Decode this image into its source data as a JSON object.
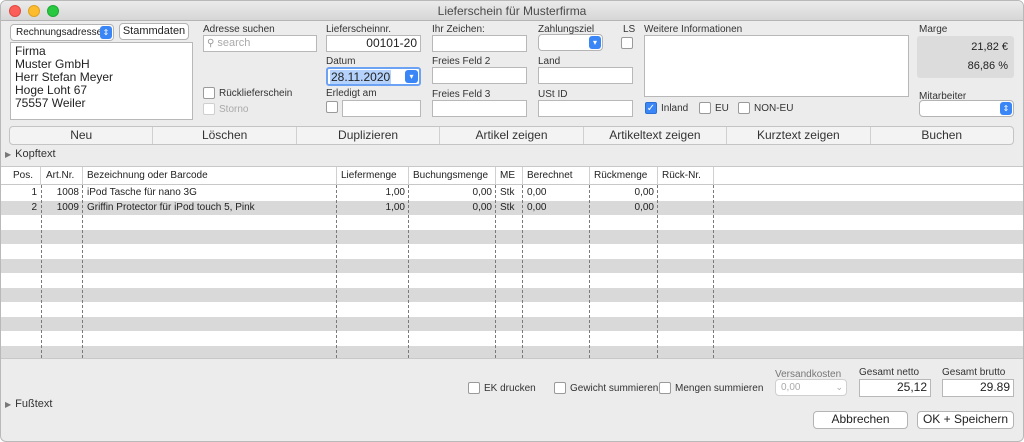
{
  "window": {
    "title": "Lieferschein für Musterfirma",
    "traffic_lights": {
      "close_color": "#fc5f57",
      "minimize_color": "#fdbc2e",
      "zoom_color": "#28c840"
    }
  },
  "address": {
    "type_popup": "Rechnungsadresse",
    "master_data_button": "Stammdaten",
    "lines": [
      "Firma",
      "Muster GmbH",
      "Herr Stefan Meyer",
      "Hoge Loht 67",
      "75557 Weiler"
    ]
  },
  "search": {
    "label": "Adresse suchen",
    "placeholder": "search"
  },
  "options": {
    "return_label": "Rücklieferschein",
    "cancel_label": "Storno"
  },
  "delivery": {
    "number_label": "Lieferscheinnr.",
    "number": "00101-20",
    "date_label": "Datum",
    "date": "28.11.2020",
    "done_label": "Erledigt am",
    "done_value": ""
  },
  "fields": {
    "your_ref_label": "Ihr Zeichen:",
    "your_ref": "",
    "free2_label": "Freies Feld 2",
    "free2": "",
    "free3_label": "Freies Feld 3",
    "free3": "",
    "payment_label": "Zahlungsziel",
    "payment": "",
    "ls_label": "LS",
    "country_label": "Land",
    "country": "",
    "vat_label": "USt ID",
    "vat": ""
  },
  "info": {
    "label": "Weitere Informationen",
    "text": "",
    "inland_label": "Inland",
    "eu_label": "EU",
    "non_eu_label": "NON-EU"
  },
  "margin": {
    "label": "Marge",
    "amount": "21,82 €",
    "percent": "86,86 %"
  },
  "employee": {
    "label": "Mitarbeiter",
    "value": ""
  },
  "toolbar": [
    "Neu",
    "Löschen",
    "Duplizieren",
    "Artikel zeigen",
    "Artikeltext zeigen",
    "Kurztext zeigen",
    "Buchen"
  ],
  "header_text_label": "Kopftext",
  "footer_text_label": "Fußtext",
  "table": {
    "columns": [
      "Pos.",
      "Art.Nr.",
      "Bezeichnung oder Barcode",
      "Liefermenge",
      "Buchungsmenge",
      "ME",
      "Berechnet",
      "Rückmenge",
      "Rück-Nr."
    ],
    "rows": [
      [
        "1",
        "1008",
        "iPod Tasche für nano 3G",
        "1,00",
        "0,00",
        "Stk",
        "0,00",
        "0,00",
        ""
      ],
      [
        "2",
        "1009",
        "Griffin Protector für iPod touch 5, Pink",
        "1,00",
        "0,00",
        "Stk",
        "0,00",
        "0,00",
        ""
      ]
    ]
  },
  "footer": {
    "ek_label": "EK drucken",
    "weight_label": "Gewicht summieren",
    "qty_label": "Mengen summieren",
    "shipping_label": "Versandkosten",
    "shipping_value": "0,00",
    "net_label": "Gesamt netto",
    "net_value": "25,12",
    "gross_label": "Gesamt brutto",
    "gross_value": "29.89",
    "cancel_button": "Abbrechen",
    "save_button": "OK + Speichern"
  }
}
